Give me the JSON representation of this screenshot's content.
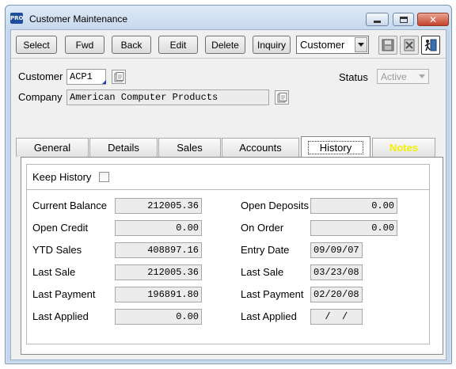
{
  "window": {
    "title": "Customer Maintenance",
    "app_badge": "PRO"
  },
  "toolbar": {
    "select": "Select",
    "fwd": "Fwd",
    "back": "Back",
    "edit": "Edit",
    "delete": "Delete",
    "inquiry": "Inquiry",
    "mode_value": "Customer"
  },
  "header": {
    "customer_label": "Customer",
    "customer_value": "ACP1",
    "company_label": "Company",
    "company_value": "American Computer Products",
    "status_label": "Status",
    "status_value": "Active"
  },
  "tabs": [
    {
      "label": "General"
    },
    {
      "label": "Details"
    },
    {
      "label": "Sales"
    },
    {
      "label": "Accounts"
    },
    {
      "label": "History"
    },
    {
      "label": "Notes"
    }
  ],
  "history": {
    "keep_history_label": "Keep History",
    "keep_history_checked": false,
    "left": [
      {
        "label": "Current Balance",
        "value": "212005.36"
      },
      {
        "label": "Open Credit",
        "value": "0.00"
      },
      {
        "label": "YTD Sales",
        "value": "408897.16"
      },
      {
        "label": "Last Sale",
        "value": "212005.36"
      },
      {
        "label": "Last Payment",
        "value": "196891.80"
      },
      {
        "label": "Last Applied",
        "value": "0.00"
      }
    ],
    "right": [
      {
        "label": "Open Deposits",
        "value": "0.00"
      },
      {
        "label": "On Order",
        "value": "0.00"
      },
      {
        "label": "Entry Date",
        "value": "09/09/07"
      },
      {
        "label": "Last Sale",
        "value": "03/23/08"
      },
      {
        "label": "Last Payment",
        "value": "02/20/08"
      },
      {
        "label": "Last Applied",
        "value": "  /  /"
      }
    ]
  },
  "icons": {
    "lookup": "lookup-icon",
    "save": "save-icon",
    "clear": "clear-icon",
    "exit": "exit-door-icon"
  },
  "colors": {
    "notes_tab": "#f5f000",
    "title_bar": "#c7d8ee"
  }
}
